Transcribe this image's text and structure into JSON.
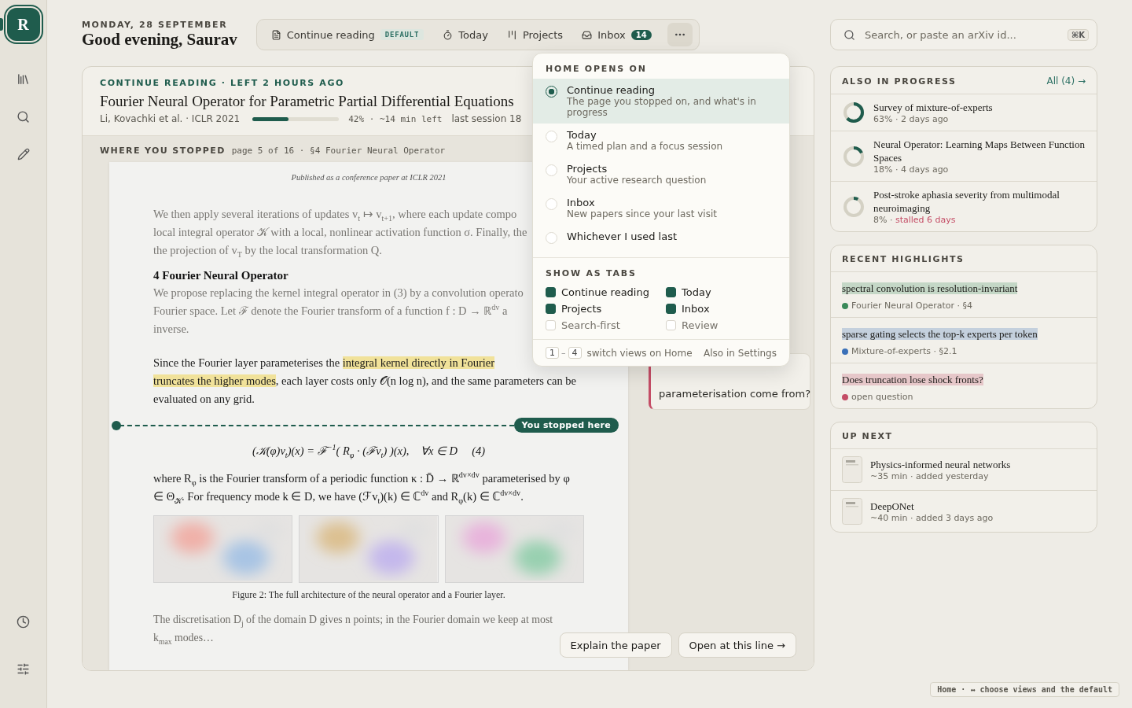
{
  "sidebar": {
    "logo": "R"
  },
  "header": {
    "date": "MONDAY, 28 SEPTEMBER",
    "greeting": "Good evening, Saurav"
  },
  "tabs": [
    {
      "kind": "reading",
      "label": "Continue reading",
      "badge": "DEFAULT"
    },
    {
      "kind": "today",
      "label": "Today"
    },
    {
      "kind": "projects",
      "label": "Projects"
    },
    {
      "kind": "inbox",
      "label": "Inbox",
      "count": "14"
    }
  ],
  "more_button": {
    "expanded": true
  },
  "search": {
    "placeholder": "Search, or paste an arXiv id...",
    "shortcut": "⌘K"
  },
  "continue": {
    "eyebrow": "CONTINUE READING · LEFT 2 HOURS AGO",
    "title": "Fourier Neural Operator for Parametric Partial Differential Equations",
    "authors": "Li, Kovachki et al. · ICLR 2021",
    "level": 0.42,
    "progress": "42% · ~14 min left",
    "session": "last session 18",
    "stopped_label": "WHERE YOU STOPPED",
    "stopped_location": "page 5 of 16 · §4 Fourier Neural Operator",
    "paper": {
      "running_head": "Published as a conference paper at ICLR 2021",
      "blocks": [
        {
          "kind": "faded",
          "text": "We then apply several iterations of updates v$_{t}$ ↦ v$_{t+1}$, where each update compo\nlocal integral operator 𝒦 with a local, nonlinear activation function σ. Finally, the\nthe projection of v$_{T}$ by the local transformation Q."
        },
        {
          "kind": "heading",
          "text": "4  Fourier Neural Operator"
        },
        {
          "kind": "faded",
          "text": "We propose replacing the kernel integral operator in (3) by a convolution operato\nFourier space. Let ℱ denote the Fourier transform of a function f : D → ℝ$^{dv}$ a\ninverse."
        },
        {
          "kind": "segments",
          "segments": [
            {
              "text": "Since the Fourier layer parameterises the ",
              "highlighted": false
            },
            {
              "text": "integral kernel directly in Fourier\n",
              "highlighted": true
            },
            {
              "text": "truncates the higher modes",
              "highlighted": true
            },
            {
              "text": ", each layer costs only 𝒪(n log n), and the same parameters can be\nevaluated on any grid.",
              "highlighted": false
            }
          ]
        },
        {
          "kind": "marker",
          "text": "You stopped here"
        },
        {
          "kind": "equation",
          "text": "(𝒦(φ)v$_{t}$)(x) = ℱ$^{−1}$( R$_{φ}$ · (ℱv$_{t}$) )(x),    ∀x ∈ D     (4)"
        },
        {
          "kind": "body",
          "text": "where R$_{φ}$ is the Fourier transform of a periodic function κ : D̄ → ℝ$^{dv×dv}$ parameterised by φ\n∈ Θ$_{𝒦}$. For frequency mode k ∈ D, we have (ℱv$_{t}$)(k) ∈ ℂ$^{dv}$ and R$_{φ}$(k) ∈ ℂ$^{dv×dv}$."
        },
        {
          "kind": "figure",
          "caption": "Figure 2: The full architecture of the neural operator and a Fourier layer."
        },
        {
          "kind": "fading",
          "text": "The discretisation D$_{j}$ of the domain D gives n points; in the Fourier domain we keep at most\nk$_{max}$ modes…"
        }
      ]
    },
    "note": "parameterisation come from?",
    "actions": [
      "Explain the paper",
      "Open at this line →"
    ]
  },
  "menu": {
    "title": "HOME OPENS ON",
    "options": [
      {
        "label": "Continue reading",
        "description": "The page you stopped on, and what's in progress",
        "selected": true
      },
      {
        "label": "Today",
        "description": "A timed plan and a focus session",
        "selected": false
      },
      {
        "label": "Projects",
        "description": "Your active research question",
        "selected": false
      },
      {
        "label": "Inbox",
        "description": "New papers since your last visit",
        "selected": false
      },
      {
        "label": "Whichever I used last",
        "selected": false
      }
    ],
    "tabs_title": "SHOW AS TABS",
    "tab_options": [
      {
        "label": "Continue reading",
        "checked": true
      },
      {
        "label": "Today",
        "checked": true
      },
      {
        "label": "Projects",
        "checked": true
      },
      {
        "label": "Inbox",
        "checked": true
      },
      {
        "label": "Search-first",
        "checked": false
      },
      {
        "label": "Review",
        "checked": false
      }
    ],
    "keys": [
      "1",
      "–",
      "4"
    ],
    "keys_hint": "switch views on Home",
    "settings_link": "Also in Settings"
  },
  "in_progress": {
    "title": "ALSO IN PROGRESS",
    "link": "All (4) →",
    "items": [
      {
        "title": "Survey of mixture-of-experts",
        "meta": "63% · 2 days ago",
        "level": 0.63
      },
      {
        "title": "Neural Operator: Learning Maps Between Function Spaces",
        "meta": "18% · 4 days ago",
        "level": 0.18
      },
      {
        "title": "Post-stroke aphasia severity from multimodal neuroimaging",
        "meta": "8% · ",
        "alert": "stalled 6 days",
        "level": 0.08
      }
    ]
  },
  "highlights": {
    "title": "RECENT HIGHLIGHTS",
    "items": [
      {
        "text": "spectral convolution is resolution-invariant",
        "source": "Fourier Neural Operator · §4",
        "color": "#3a8a5a"
      },
      {
        "text": "sparse gating selects the top-k experts per token",
        "source": "Mixture-of-experts · §2.1",
        "color": "#3a70b8"
      },
      {
        "text": "Does truncation lose shock fronts?",
        "source": "open question",
        "color": "#c44d66"
      }
    ]
  },
  "up_next": {
    "title": "UP NEXT",
    "items": [
      {
        "title": "Physics-informed neural networks",
        "meta": "~35 min · added yesterday"
      },
      {
        "title": "DeepONet",
        "meta": "~40 min · added 3 days ago"
      }
    ]
  },
  "footer_hint": "Home · ↔ choose views and the default"
}
